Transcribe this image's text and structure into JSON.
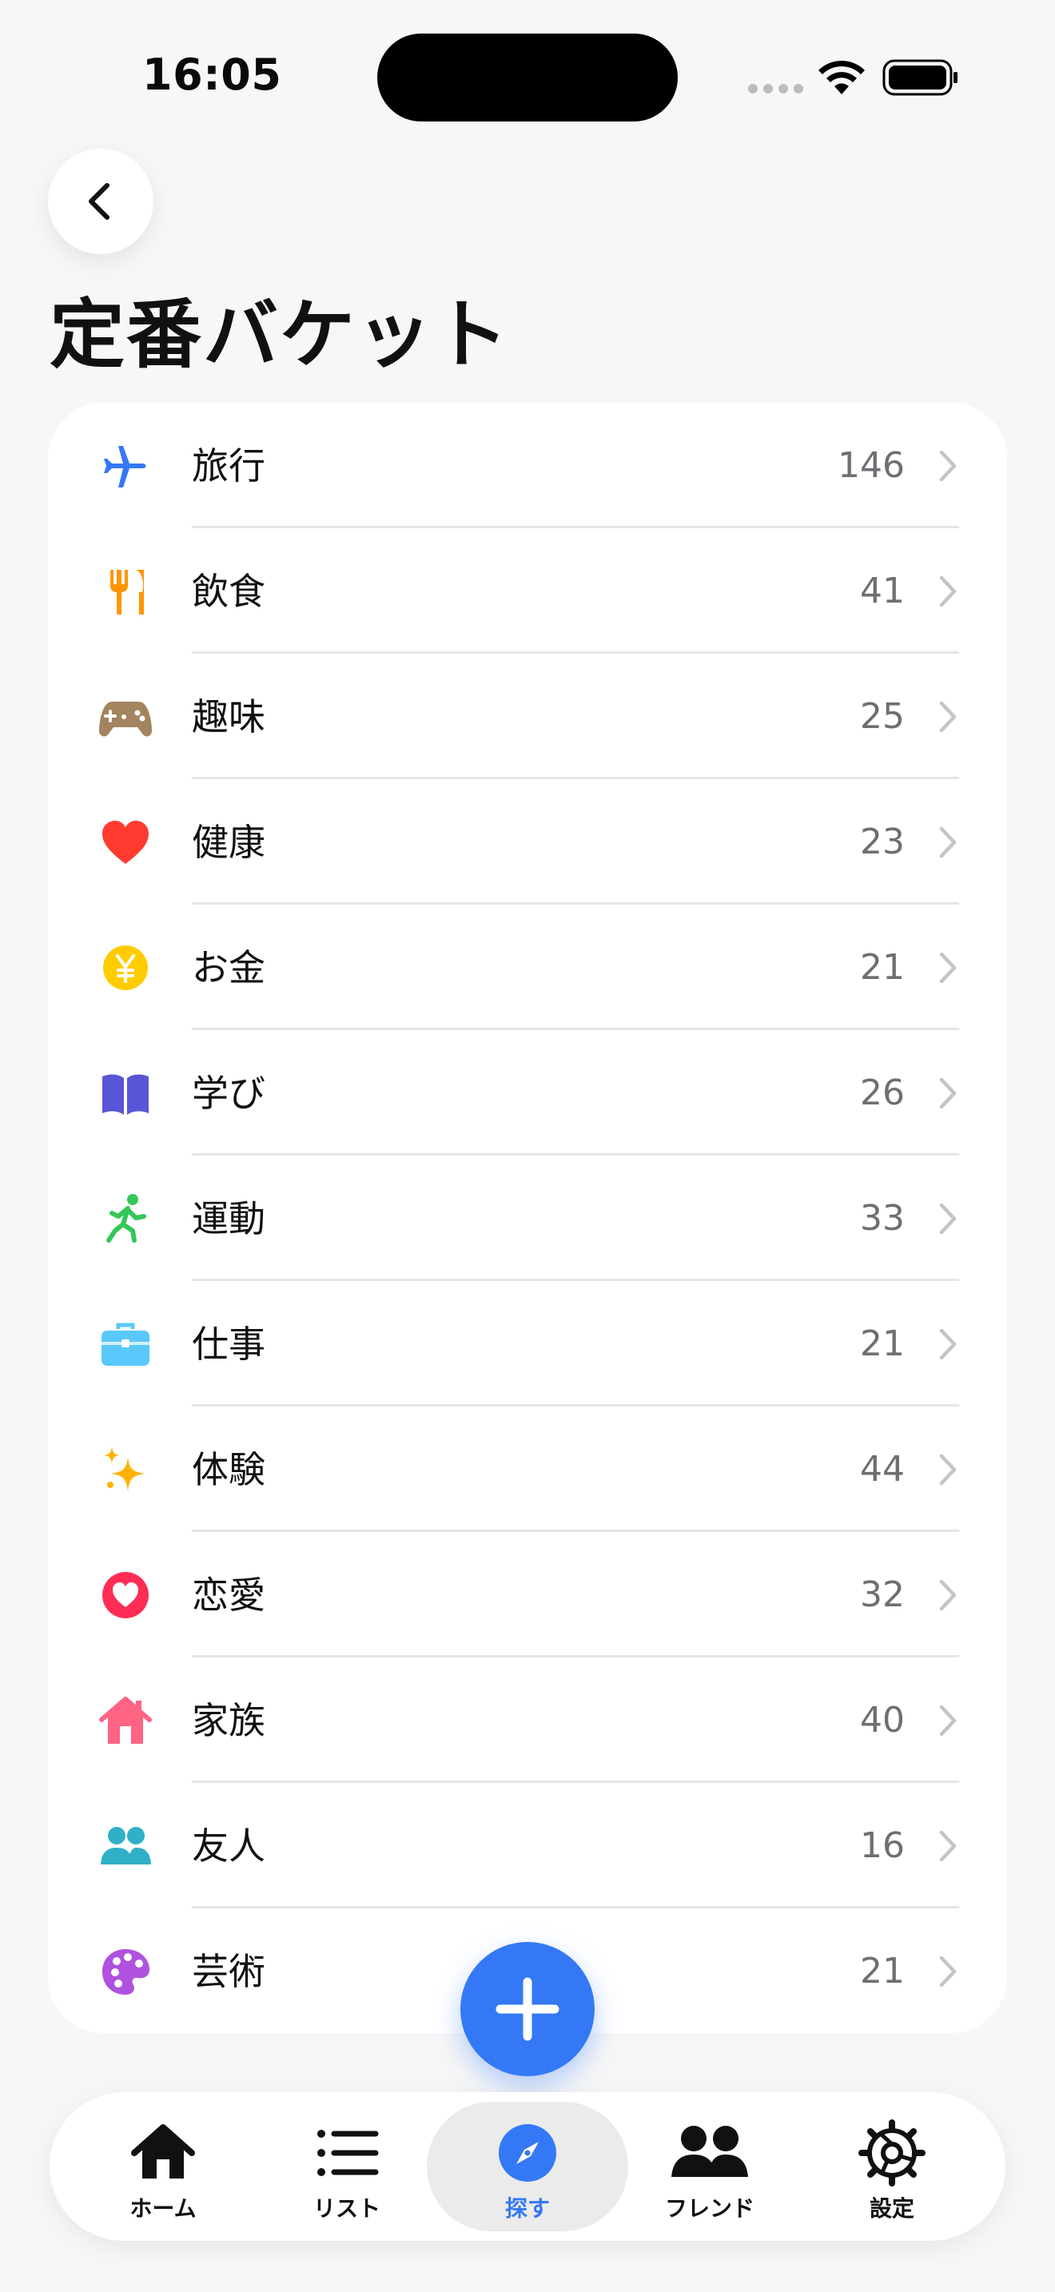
{
  "status_bar": {
    "time": "16:05"
  },
  "header": {
    "title": "定番バケット"
  },
  "categories": [
    {
      "label": "旅行",
      "count": "146",
      "icon": "airplane-icon",
      "color": "#3478f6"
    },
    {
      "label": "飲食",
      "count": "41",
      "icon": "fork-knife-icon",
      "color": "#ff9500"
    },
    {
      "label": "趣味",
      "count": "25",
      "icon": "gamecontroller-icon",
      "color": "#a2845e"
    },
    {
      "label": "健康",
      "count": "23",
      "icon": "heart-icon",
      "color": "#ff3b30"
    },
    {
      "label": "お金",
      "count": "21",
      "icon": "yen-coin-icon",
      "color": "#ffcc00"
    },
    {
      "label": "学び",
      "count": "26",
      "icon": "book-icon",
      "color": "#5856d6"
    },
    {
      "label": "運動",
      "count": "33",
      "icon": "running-figure-icon",
      "color": "#34c759"
    },
    {
      "label": "仕事",
      "count": "21",
      "icon": "briefcase-icon",
      "color": "#5ac8fa"
    },
    {
      "label": "体験",
      "count": "44",
      "icon": "sparkles-icon",
      "color": "#ffb300"
    },
    {
      "label": "恋愛",
      "count": "32",
      "icon": "heart-circle-icon",
      "color": "#ff2d55"
    },
    {
      "label": "家族",
      "count": "40",
      "icon": "house-icon",
      "color": "#ff6482"
    },
    {
      "label": "友人",
      "count": "16",
      "icon": "people-icon",
      "color": "#30b0c7"
    },
    {
      "label": "芸術",
      "count": "21",
      "icon": "palette-icon",
      "color": "#af52de"
    }
  ],
  "fab": {
    "icon": "plus-icon",
    "color": "#3478f6"
  },
  "tab_bar": {
    "items": [
      {
        "label": "ホーム",
        "icon": "house-fill-icon"
      },
      {
        "label": "リスト",
        "icon": "list-icon"
      },
      {
        "label": "探す",
        "icon": "compass-icon",
        "active": true
      },
      {
        "label": "フレンド",
        "icon": "people-fill-icon"
      },
      {
        "label": "設定",
        "icon": "gear-icon"
      }
    ]
  }
}
